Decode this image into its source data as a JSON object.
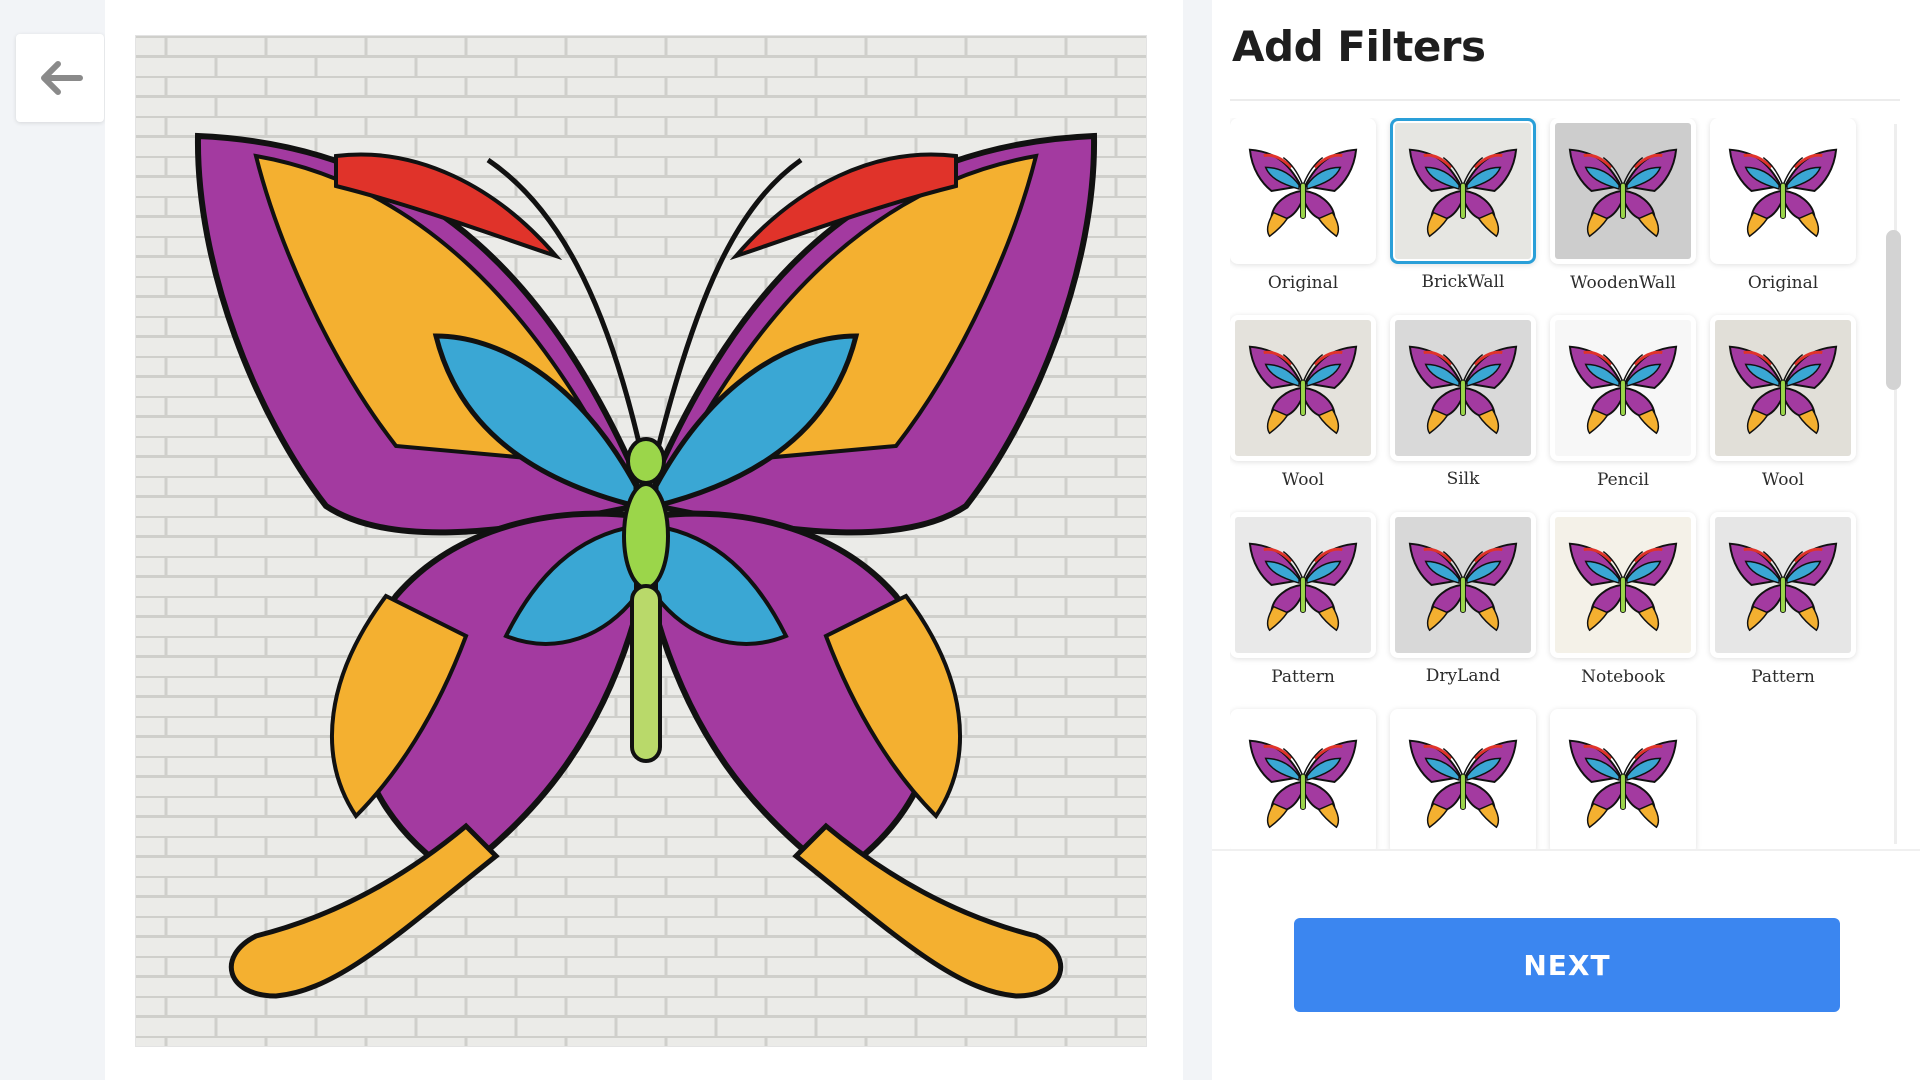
{
  "back": {
    "icon": "arrow-left-icon"
  },
  "panel": {
    "title": "Add Filters"
  },
  "filters": [
    {
      "label": "Original",
      "bg": "#ffffff",
      "selected": false
    },
    {
      "label": "BrickWall",
      "bg": "#e6e6e2",
      "selected": true
    },
    {
      "label": "WoodenWall",
      "bg": "#cdcdcd",
      "selected": false
    },
    {
      "label": "Original",
      "bg": "#ffffff",
      "selected": false
    },
    {
      "label": "Wool",
      "bg": "#e4e2dc",
      "selected": false
    },
    {
      "label": "Silk",
      "bg": "#d9d9d9",
      "selected": false
    },
    {
      "label": "Pencil",
      "bg": "#f7f7f7",
      "selected": false
    },
    {
      "label": "Wool",
      "bg": "#e1dfd8",
      "selected": false
    },
    {
      "label": "Pattern",
      "bg": "#e9e9e9",
      "selected": false
    },
    {
      "label": "DryLand",
      "bg": "#d8d8d8",
      "selected": false
    },
    {
      "label": "Notebook",
      "bg": "#f4f1e8",
      "selected": false
    },
    {
      "label": "Pattern",
      "bg": "#e6e6e6",
      "selected": false
    },
    {
      "label": "",
      "bg": "#ffffff",
      "selected": false
    },
    {
      "label": "",
      "bg": "#ffffff",
      "selected": false
    },
    {
      "label": "",
      "bg": "#ffffff",
      "selected": false
    }
  ],
  "next": {
    "label": "NEXT"
  },
  "colors": {
    "accent": "#3b86f0",
    "selected_border": "#2a9fd8"
  }
}
